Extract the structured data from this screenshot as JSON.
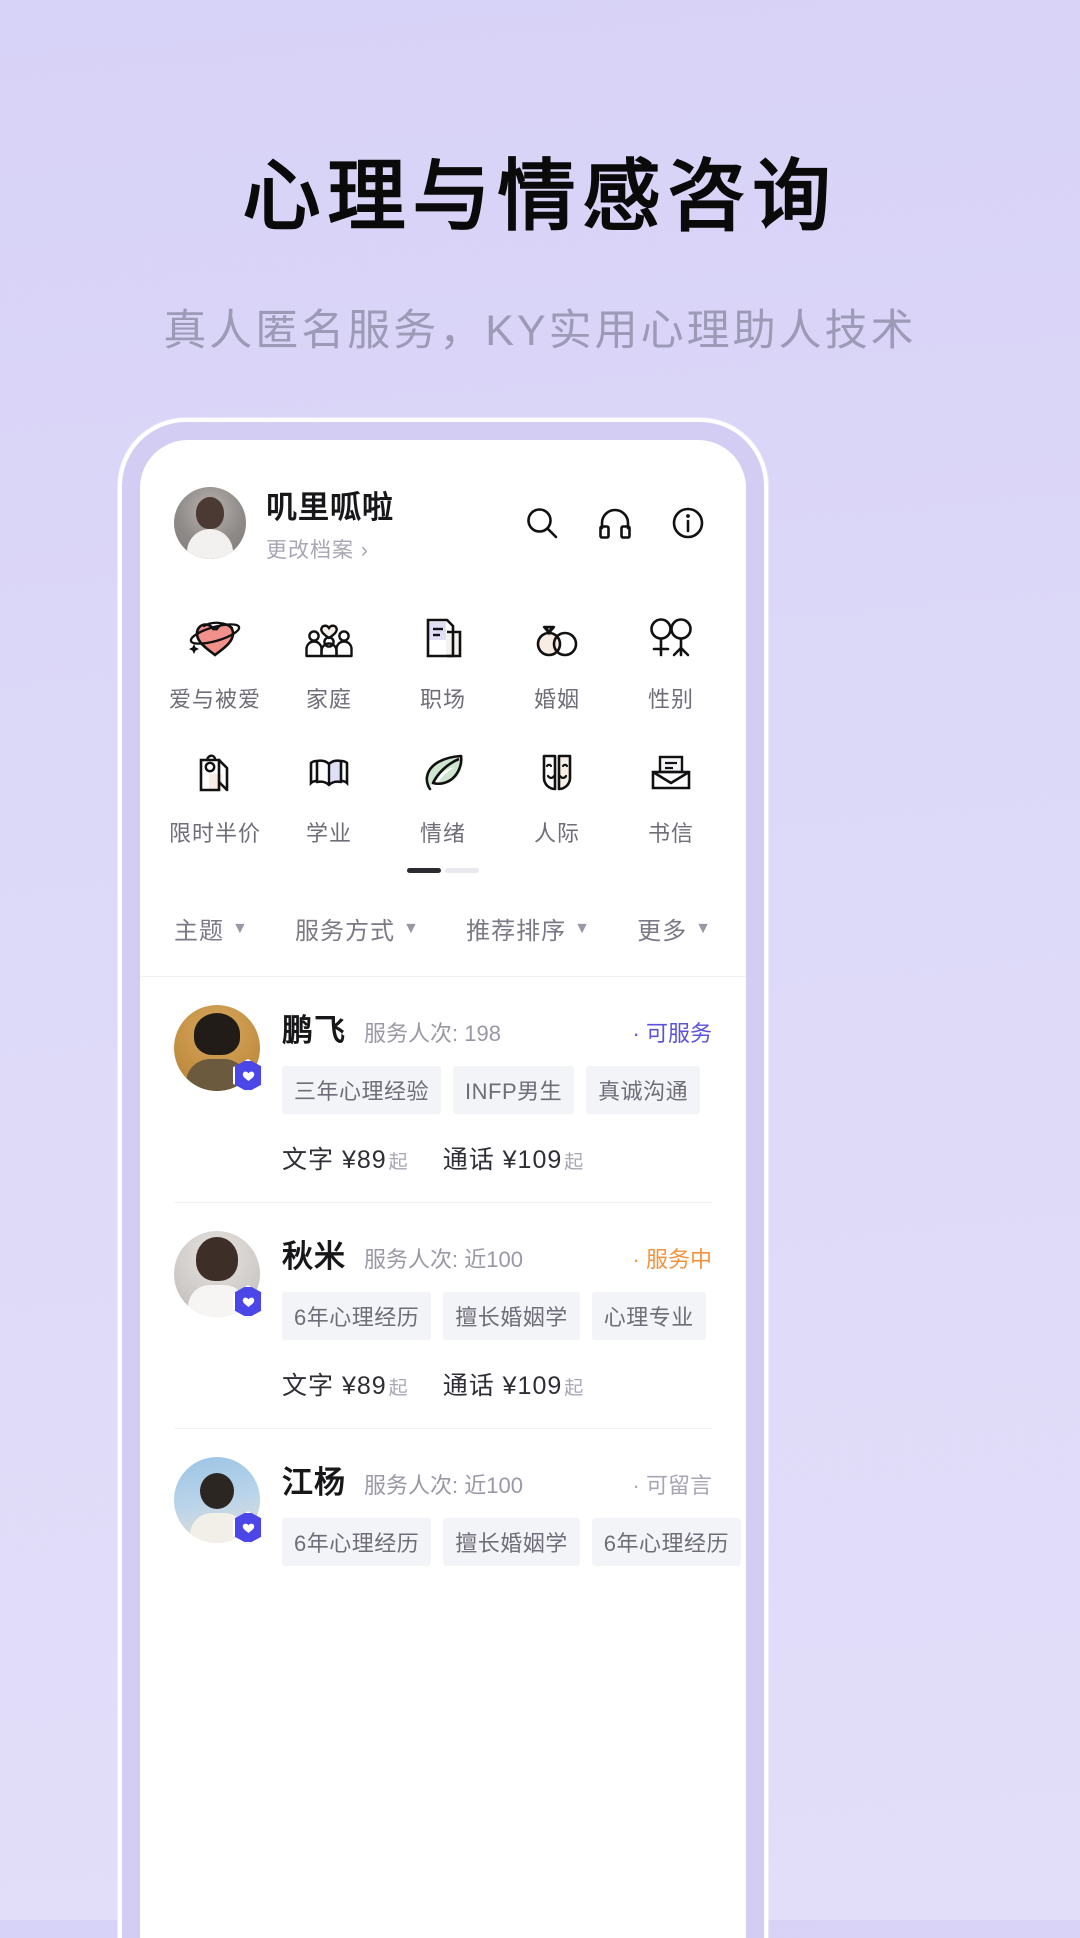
{
  "promo": {
    "title": "心理与情感咨询",
    "subtitle": "真人匿名服务，KY实用心理助人技术"
  },
  "colors": {
    "page_background": "#dcd8f8",
    "bezel": "#d3cdf4",
    "accent_purple": "#5b52d8",
    "badge_purple": "#4b46e8",
    "status_orange": "#f5923e",
    "tag_background": "#f3f4f8",
    "muted_text": "#9a98a6"
  },
  "profile": {
    "name": "叽里呱啦",
    "edit_link": "更改档案",
    "chevron": "›",
    "avatar_name": "user-avatar",
    "icons": [
      {
        "name": "search-icon",
        "label": "搜索"
      },
      {
        "name": "headphones-icon",
        "label": "客服"
      },
      {
        "name": "info-icon",
        "label": "说明"
      }
    ]
  },
  "categories": [
    {
      "label": "爱与被爱",
      "icon": "heart-orbit-icon"
    },
    {
      "label": "家庭",
      "icon": "family-icon"
    },
    {
      "label": "职场",
      "icon": "document-icon"
    },
    {
      "label": "婚姻",
      "icon": "wedding-rings-icon"
    },
    {
      "label": "性别",
      "icon": "gender-symbols-icon"
    },
    {
      "label": "限时半价",
      "icon": "price-tag-icon"
    },
    {
      "label": "学业",
      "icon": "open-book-icon"
    },
    {
      "label": "情绪",
      "icon": "leaf-icon"
    },
    {
      "label": "人际",
      "icon": "two-faces-icon"
    },
    {
      "label": "书信",
      "icon": "letter-envelope-icon"
    }
  ],
  "pager": {
    "pages": 2,
    "active": 1
  },
  "filters": [
    {
      "label": "主题",
      "caret": "▼"
    },
    {
      "label": "服务方式",
      "caret": "▼"
    },
    {
      "label": "推荐排序",
      "caret": "▼"
    },
    {
      "label": "更多",
      "caret": "▼"
    }
  ],
  "consultants": [
    {
      "name": "鹏飞",
      "meta": "服务人次: 198",
      "status": "· 可服务",
      "status_color": "purple",
      "avatar_class": "av-a",
      "tags": [
        "三年心理经验",
        "INFP男生",
        "真诚沟通"
      ],
      "prices": [
        {
          "label": "文字 ¥89",
          "suffix": "起"
        },
        {
          "label": "通话 ¥109",
          "suffix": "起"
        }
      ]
    },
    {
      "name": "秋米",
      "meta": "服务人次: 近100",
      "status": "· 服务中",
      "status_color": "orange",
      "avatar_class": "av-b",
      "tags": [
        "6年心理经历",
        "擅长婚姻学",
        "心理专业"
      ],
      "prices": [
        {
          "label": "文字 ¥89",
          "suffix": "起"
        },
        {
          "label": "通话 ¥109",
          "suffix": "起"
        }
      ]
    },
    {
      "name": "江杨",
      "meta": "服务人次: 近100",
      "status": "· 可留言",
      "status_color": "gray",
      "avatar_class": "av-c",
      "tags": [
        "6年心理经历",
        "擅长婚姻学",
        "6年心理经历"
      ],
      "prices": []
    }
  ]
}
